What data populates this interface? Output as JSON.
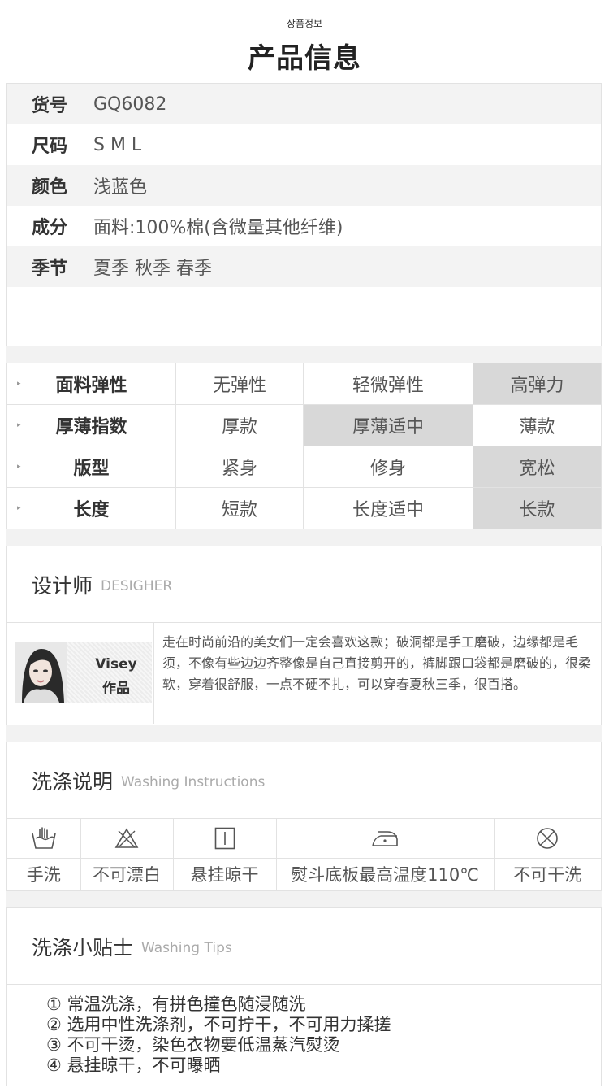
{
  "header": {
    "korean": "상품정보",
    "chinese": "产品信息"
  },
  "product_info": [
    {
      "label": "货号",
      "value": "GQ6082"
    },
    {
      "label": "尺码",
      "value": "S M L"
    },
    {
      "label": "颜色",
      "value": "浅蓝色"
    },
    {
      "label": "成分",
      "value": "面料:100%棉(含微量其他纤维)"
    },
    {
      "label": "季节",
      "value": "夏季 秋季 春季"
    }
  ],
  "attributes": [
    {
      "label": "面料弹性",
      "options": [
        "无弹性",
        "轻微弹性",
        "高弹力"
      ],
      "selected": 2
    },
    {
      "label": "厚薄指数",
      "options": [
        "厚款",
        "厚薄适中",
        "薄款"
      ],
      "selected": 1
    },
    {
      "label": "版型",
      "options": [
        "紧身",
        "修身",
        "宽松"
      ],
      "selected": 2
    },
    {
      "label": "长度",
      "options": [
        "短款",
        "长度适中",
        "长款"
      ],
      "selected": 2
    }
  ],
  "designer": {
    "title": "设计师",
    "title_en": "DESIGHER",
    "name": "Visey",
    "work": "作品",
    "text": "走在时尚前沿的美女们一定会喜欢这款；破洞都是手工磨破，边缘都是毛须，不像有些边边齐整像是自己直接剪开的，裤脚跟口袋都是磨破的，很柔软，穿着很舒服，一点不硬不扎，可以穿春夏秋三季，很百搭。"
  },
  "washing": {
    "title": "洗涤说明",
    "title_en": "Washing Instructions",
    "items": [
      {
        "icon": "hand-wash-icon",
        "label": "手洗"
      },
      {
        "icon": "no-bleach-icon",
        "label": "不可漂白"
      },
      {
        "icon": "hang-dry-icon",
        "label": "悬挂晾干"
      },
      {
        "icon": "iron-icon",
        "label": "熨斗底板最高温度110℃"
      },
      {
        "icon": "no-dry-clean-icon",
        "label": "不可干洗"
      }
    ]
  },
  "tips": {
    "title": "洗涤小贴士",
    "title_en": "Washing Tips",
    "items": [
      "① 常温洗涤，有拼色撞色随浸随洗",
      "② 选用中性洗涤剂，不可拧干，不可用力揉搓",
      "③ 不可干烫，染色衣物要低温蒸汽熨烫",
      "④ 悬挂晾干，不可曝晒"
    ]
  }
}
